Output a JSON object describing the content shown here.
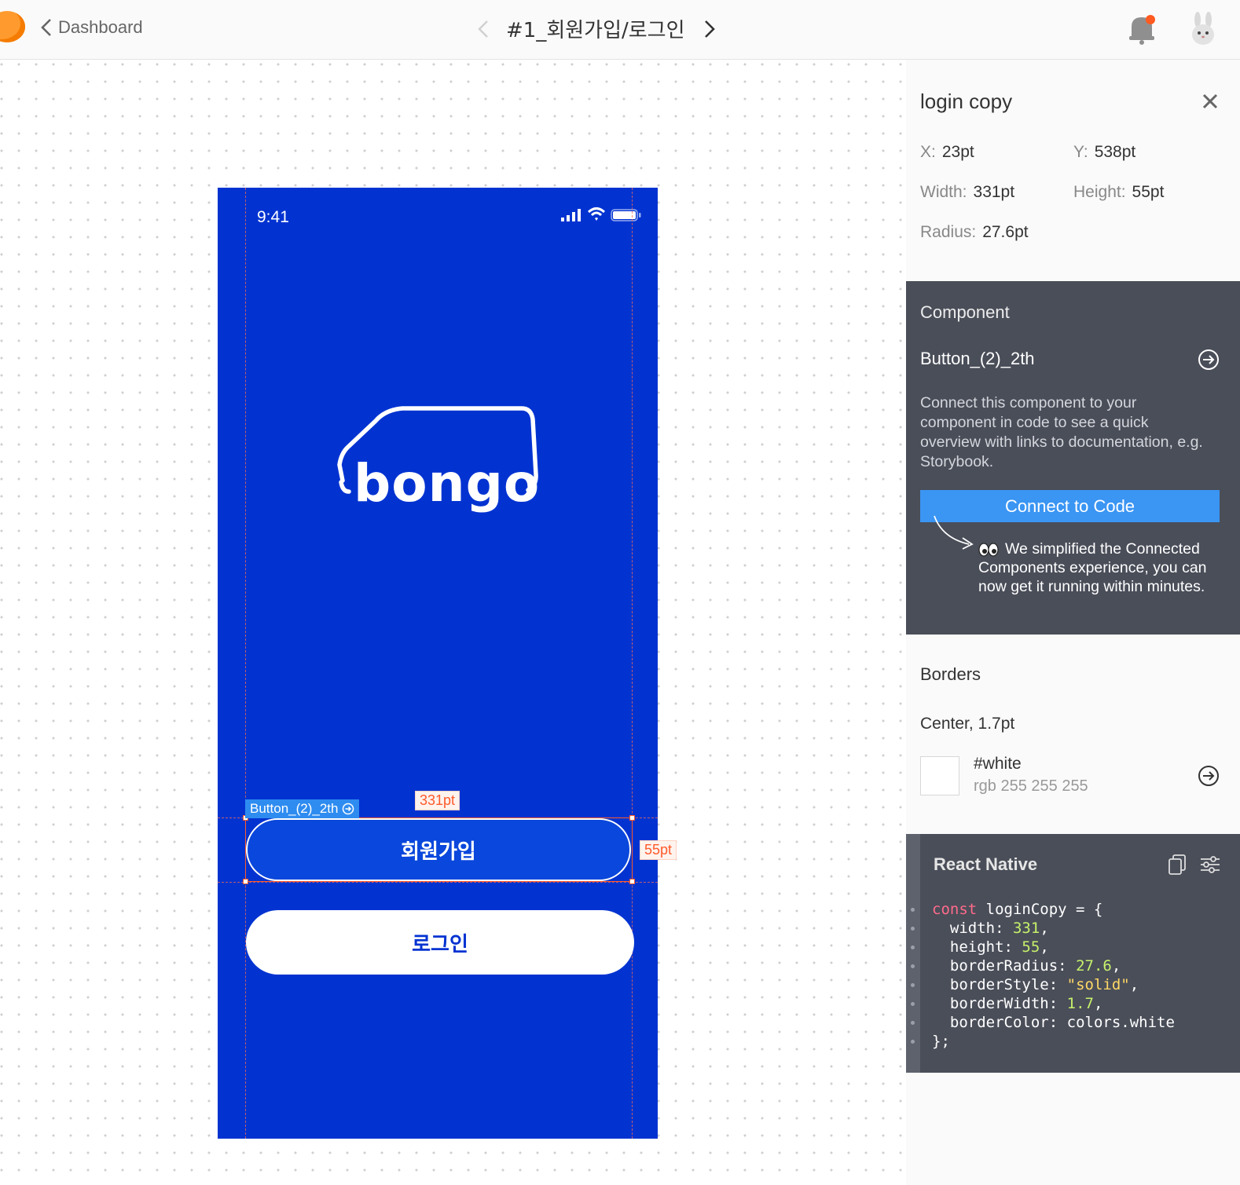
{
  "topbar": {
    "back_label": "Dashboard",
    "screen_title": "#1_회원가입/로그인"
  },
  "artboard": {
    "status_time": "9:41",
    "logo_text": "bongo",
    "signup_label": "회원가입",
    "login_label": "로그인",
    "background_color": "#0233d1",
    "selection": {
      "component_tag": "Button_(2)_2th",
      "width_tag": "331pt",
      "height_tag": "55pt"
    }
  },
  "panel": {
    "layer_name": "login copy",
    "props": {
      "x_label": "X:",
      "x_value": "23pt",
      "y_label": "Y:",
      "y_value": "538pt",
      "width_label": "Width:",
      "width_value": "331pt",
      "height_label": "Height:",
      "height_value": "55pt",
      "radius_label": "Radius:",
      "radius_value": "27.6pt"
    },
    "component": {
      "heading": "Component",
      "name": "Button_(2)_2th",
      "description": "Connect this component to your component in code to see a quick overview with links to documentation, e.g. Storybook.",
      "connect_label": "Connect to Code",
      "hint": "We simplified the Connected Components experience, you can now get it running within minutes."
    },
    "borders": {
      "heading": "Borders",
      "value": "Center, 1.7pt",
      "color_name": "#white",
      "color_rgb": "rgb 255 255 255",
      "swatch_color": "#ffffff"
    },
    "code": {
      "heading": "React Native",
      "var_keyword": "const",
      "var_name": "loginCopy = {",
      "width_key": "width:",
      "width_val": "331",
      "height_key": "height:",
      "height_val": "55",
      "radius_key": "borderRadius:",
      "radius_val": "27.6",
      "style_key": "borderStyle:",
      "style_val": "\"solid\"",
      "bw_key": "borderWidth:",
      "bw_val": "1.7",
      "bc_key": "borderColor:",
      "bc_val": "colors.white",
      "close": "};"
    }
  }
}
